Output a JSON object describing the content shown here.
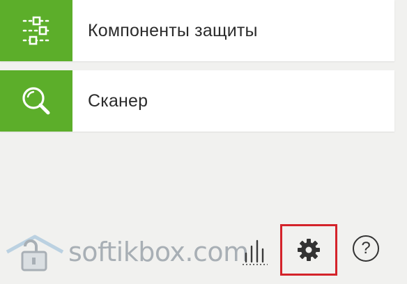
{
  "menu": {
    "components_label": "Компоненты защиты",
    "scanner_label": "Сканер"
  },
  "bottom": {
    "watermark_text": "softikbox.com",
    "help_symbol": "?"
  },
  "icons": {
    "components": "sliders-icon",
    "scanner": "magnifier-icon",
    "stats": "bar-chart-icon",
    "settings": "gear-icon",
    "help": "question-icon",
    "watermark": "watermark-lock-icon"
  },
  "colors": {
    "accent_green": "#5cae2a",
    "highlight_red": "#d4232a",
    "background": "#f1f1ef",
    "tile_background": "#ffffff",
    "text": "#2b2b2b"
  }
}
